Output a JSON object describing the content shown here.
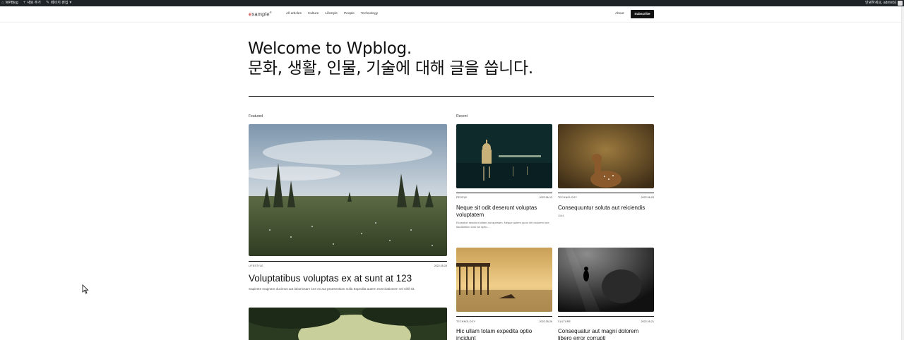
{
  "admin_bar": {
    "site_name": "WPBlog",
    "new_label": "새로 추가",
    "edit_label": "페이지 편집",
    "greeting": "안녕하세요, admin님"
  },
  "header": {
    "logo_prefix": "e",
    "logo_rest": "xample",
    "nav": [
      "All articles",
      "Culture",
      "Lifestyle",
      "People",
      "Technology"
    ],
    "about": "About",
    "subscribe": "Subscribe"
  },
  "hero": {
    "line1": "Welcome to Wpblog.",
    "line2": "문화, 생활, 인물, 기술에 대해 글을 씁니다."
  },
  "featured": {
    "label": "Featured",
    "post": {
      "category": "LIFESTYLE",
      "date": "2022-05-25",
      "title": "Voluptatibus voluptas ex at sunt at 123",
      "excerpt": "Sapiente magnam ducimus aut laboriosam iure ex aut praesentium nulla Expedita autem exercitationem vel nihil sit."
    }
  },
  "recent": {
    "label": "Recent",
    "posts": [
      {
        "category": "PEOPLE",
        "date": "2022-06-13",
        "title": "Neque sit odit deserunt voluptas voluptatem",
        "excerpt": "Excepturi nesciunt ullam aut aperiam. Neque autem quos Vel dolorem iure laudantium cum ad optio..."
      },
      {
        "category": "TECHNOLOGY",
        "date": "2022-06-03",
        "title": "Consequuntur soluta aut reiciendis",
        "excerpt": "1144"
      },
      {
        "category": "TECHNOLOGY",
        "date": "2022-05-26",
        "title": "Hic ullam totam expedita optio incidunt",
        "excerpt": ""
      },
      {
        "category": "CULTURE",
        "date": "2022-05-21",
        "title": "Consequatur aut magni dolorem libero error corrupti",
        "excerpt": ""
      }
    ]
  }
}
